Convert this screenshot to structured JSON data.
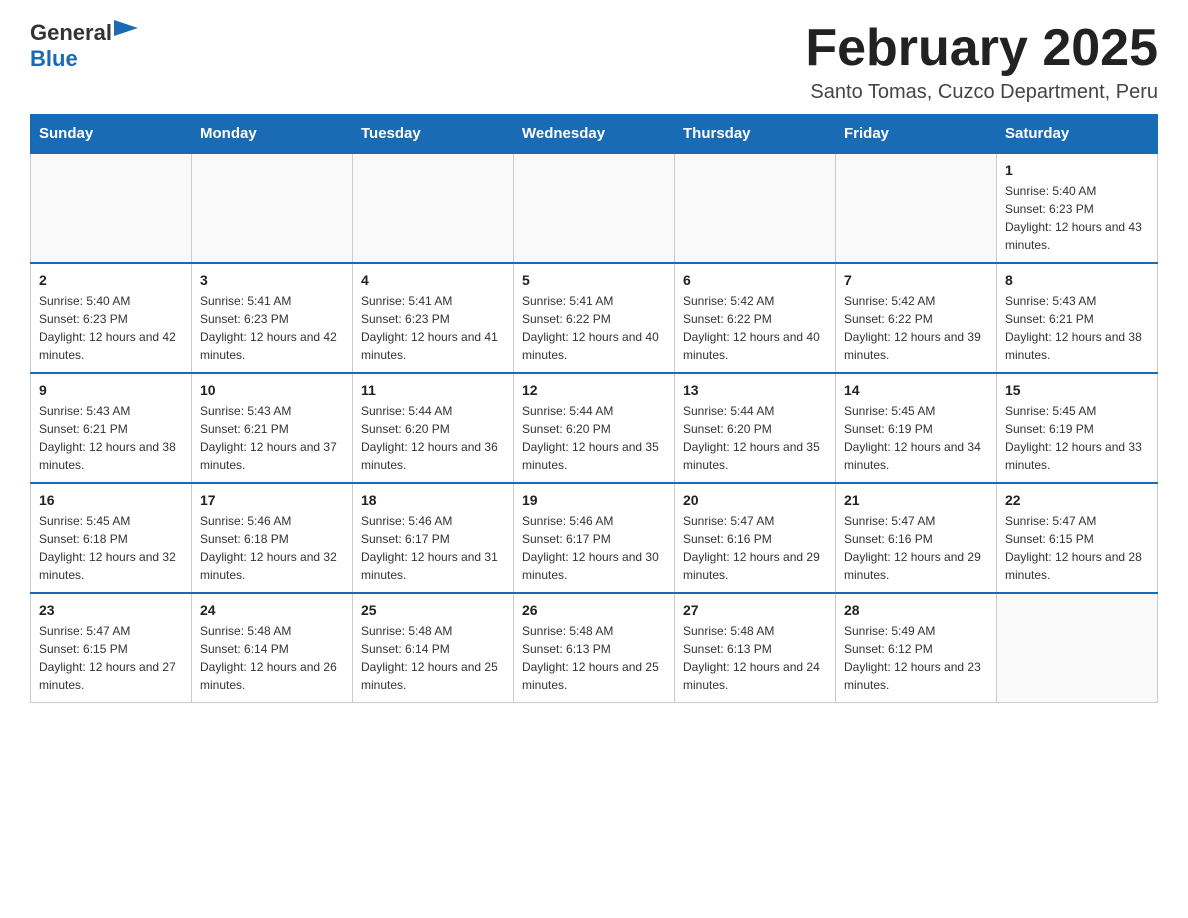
{
  "logo": {
    "general": "General",
    "blue": "Blue"
  },
  "header": {
    "month_year": "February 2025",
    "location": "Santo Tomas, Cuzco Department, Peru"
  },
  "days_of_week": [
    "Sunday",
    "Monday",
    "Tuesday",
    "Wednesday",
    "Thursday",
    "Friday",
    "Saturday"
  ],
  "weeks": [
    [
      {
        "day": "",
        "info": ""
      },
      {
        "day": "",
        "info": ""
      },
      {
        "day": "",
        "info": ""
      },
      {
        "day": "",
        "info": ""
      },
      {
        "day": "",
        "info": ""
      },
      {
        "day": "",
        "info": ""
      },
      {
        "day": "1",
        "info": "Sunrise: 5:40 AM\nSunset: 6:23 PM\nDaylight: 12 hours and 43 minutes."
      }
    ],
    [
      {
        "day": "2",
        "info": "Sunrise: 5:40 AM\nSunset: 6:23 PM\nDaylight: 12 hours and 42 minutes."
      },
      {
        "day": "3",
        "info": "Sunrise: 5:41 AM\nSunset: 6:23 PM\nDaylight: 12 hours and 42 minutes."
      },
      {
        "day": "4",
        "info": "Sunrise: 5:41 AM\nSunset: 6:23 PM\nDaylight: 12 hours and 41 minutes."
      },
      {
        "day": "5",
        "info": "Sunrise: 5:41 AM\nSunset: 6:22 PM\nDaylight: 12 hours and 40 minutes."
      },
      {
        "day": "6",
        "info": "Sunrise: 5:42 AM\nSunset: 6:22 PM\nDaylight: 12 hours and 40 minutes."
      },
      {
        "day": "7",
        "info": "Sunrise: 5:42 AM\nSunset: 6:22 PM\nDaylight: 12 hours and 39 minutes."
      },
      {
        "day": "8",
        "info": "Sunrise: 5:43 AM\nSunset: 6:21 PM\nDaylight: 12 hours and 38 minutes."
      }
    ],
    [
      {
        "day": "9",
        "info": "Sunrise: 5:43 AM\nSunset: 6:21 PM\nDaylight: 12 hours and 38 minutes."
      },
      {
        "day": "10",
        "info": "Sunrise: 5:43 AM\nSunset: 6:21 PM\nDaylight: 12 hours and 37 minutes."
      },
      {
        "day": "11",
        "info": "Sunrise: 5:44 AM\nSunset: 6:20 PM\nDaylight: 12 hours and 36 minutes."
      },
      {
        "day": "12",
        "info": "Sunrise: 5:44 AM\nSunset: 6:20 PM\nDaylight: 12 hours and 35 minutes."
      },
      {
        "day": "13",
        "info": "Sunrise: 5:44 AM\nSunset: 6:20 PM\nDaylight: 12 hours and 35 minutes."
      },
      {
        "day": "14",
        "info": "Sunrise: 5:45 AM\nSunset: 6:19 PM\nDaylight: 12 hours and 34 minutes."
      },
      {
        "day": "15",
        "info": "Sunrise: 5:45 AM\nSunset: 6:19 PM\nDaylight: 12 hours and 33 minutes."
      }
    ],
    [
      {
        "day": "16",
        "info": "Sunrise: 5:45 AM\nSunset: 6:18 PM\nDaylight: 12 hours and 32 minutes."
      },
      {
        "day": "17",
        "info": "Sunrise: 5:46 AM\nSunset: 6:18 PM\nDaylight: 12 hours and 32 minutes."
      },
      {
        "day": "18",
        "info": "Sunrise: 5:46 AM\nSunset: 6:17 PM\nDaylight: 12 hours and 31 minutes."
      },
      {
        "day": "19",
        "info": "Sunrise: 5:46 AM\nSunset: 6:17 PM\nDaylight: 12 hours and 30 minutes."
      },
      {
        "day": "20",
        "info": "Sunrise: 5:47 AM\nSunset: 6:16 PM\nDaylight: 12 hours and 29 minutes."
      },
      {
        "day": "21",
        "info": "Sunrise: 5:47 AM\nSunset: 6:16 PM\nDaylight: 12 hours and 29 minutes."
      },
      {
        "day": "22",
        "info": "Sunrise: 5:47 AM\nSunset: 6:15 PM\nDaylight: 12 hours and 28 minutes."
      }
    ],
    [
      {
        "day": "23",
        "info": "Sunrise: 5:47 AM\nSunset: 6:15 PM\nDaylight: 12 hours and 27 minutes."
      },
      {
        "day": "24",
        "info": "Sunrise: 5:48 AM\nSunset: 6:14 PM\nDaylight: 12 hours and 26 minutes."
      },
      {
        "day": "25",
        "info": "Sunrise: 5:48 AM\nSunset: 6:14 PM\nDaylight: 12 hours and 25 minutes."
      },
      {
        "day": "26",
        "info": "Sunrise: 5:48 AM\nSunset: 6:13 PM\nDaylight: 12 hours and 25 minutes."
      },
      {
        "day": "27",
        "info": "Sunrise: 5:48 AM\nSunset: 6:13 PM\nDaylight: 12 hours and 24 minutes."
      },
      {
        "day": "28",
        "info": "Sunrise: 5:49 AM\nSunset: 6:12 PM\nDaylight: 12 hours and 23 minutes."
      },
      {
        "day": "",
        "info": ""
      }
    ]
  ]
}
